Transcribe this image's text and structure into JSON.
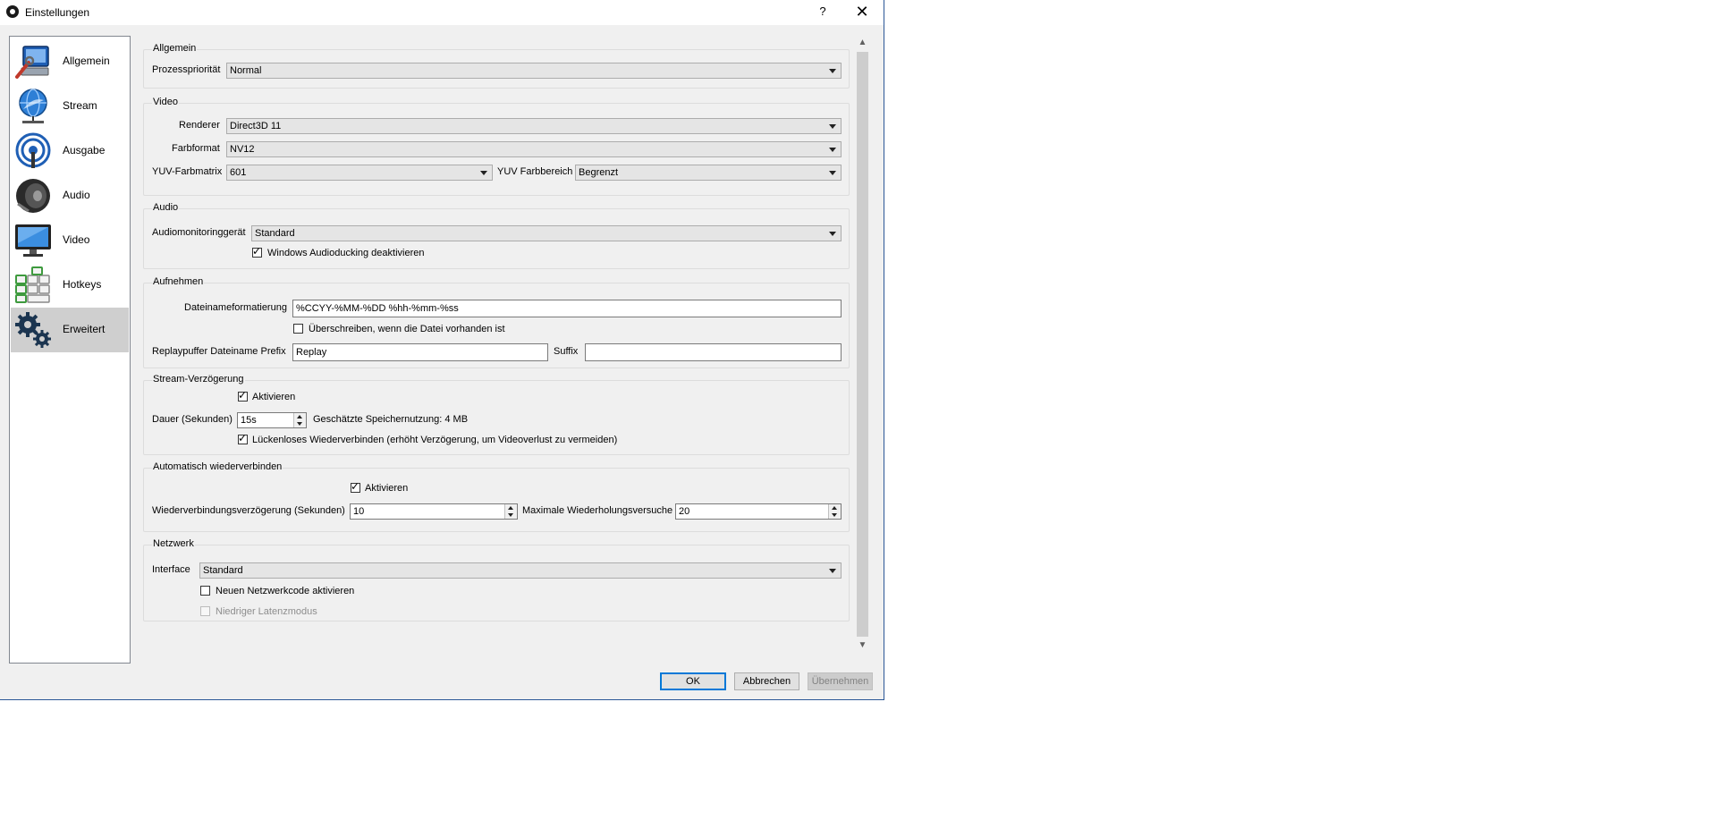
{
  "window": {
    "title": "Einstellungen",
    "help_glyph": "?",
    "close_glyph": "✕",
    "accent": "#2b5797"
  },
  "sidebar": {
    "items": [
      {
        "label": "Allgemein",
        "icon": "computer-wrench-icon",
        "selected": false
      },
      {
        "label": "Stream",
        "icon": "globe-network-icon",
        "selected": false
      },
      {
        "label": "Ausgabe",
        "icon": "broadcast-antenna-icon",
        "selected": false
      },
      {
        "label": "Audio",
        "icon": "speaker-icon",
        "selected": false
      },
      {
        "label": "Video",
        "icon": "monitor-icon",
        "selected": false
      },
      {
        "label": "Hotkeys",
        "icon": "keyboard-icon",
        "selected": false
      },
      {
        "label": "Erweitert",
        "icon": "gears-icon",
        "selected": true
      }
    ]
  },
  "general": {
    "title": "Allgemein",
    "priority_label": "Prozesspriorität",
    "priority_value": "Normal"
  },
  "video": {
    "title": "Video",
    "renderer_label": "Renderer",
    "renderer_value": "Direct3D 11",
    "color_format_label": "Farbformat",
    "color_format_value": "NV12",
    "yuv_matrix_label": "YUV-Farbmatrix",
    "yuv_matrix_value": "601",
    "yuv_range_label": "YUV Farbbereich",
    "yuv_range_value": "Begrenzt"
  },
  "audio": {
    "title": "Audio",
    "monitor_device_label": "Audiomonitoringgerät",
    "monitor_device_value": "Standard",
    "ducking_label": "Windows Audioducking deaktivieren",
    "ducking_checked": true
  },
  "recording": {
    "title": "Aufnehmen",
    "filename_format_label": "Dateinameformatierung",
    "filename_format_value": "%CCYY-%MM-%DD %hh-%mm-%ss",
    "overwrite_label": "Überschreiben, wenn die Datei vorhanden ist",
    "overwrite_checked": false,
    "replay_prefix_label": "Replaypuffer Dateiname Prefix",
    "replay_prefix_value": "Replay",
    "suffix_label": "Suffix",
    "suffix_value": ""
  },
  "stream_delay": {
    "title": "Stream-Verzögerung",
    "enable_label": "Aktivieren",
    "enable_checked": true,
    "duration_label": "Dauer (Sekunden)",
    "duration_value": "15s",
    "memory_estimate": "Geschätzte Speichernutzung: 4 MB",
    "preserve_label": "Lückenloses Wiederverbinden (erhöht Verzögerung, um Videoverlust zu vermeiden)",
    "preserve_checked": true
  },
  "reconnect": {
    "title": "Automatisch wiederverbinden",
    "enable_label": "Aktivieren",
    "enable_checked": true,
    "delay_label": "Wiederverbindungsverzögerung (Sekunden)",
    "delay_value": "10",
    "max_retries_label": "Maximale Wiederholungsversuche",
    "max_retries_value": "20"
  },
  "network": {
    "title": "Netzwerk",
    "interface_label": "Interface",
    "interface_value": "Standard",
    "new_code_label": "Neuen Netzwerkcode aktivieren",
    "new_code_checked": false,
    "low_latency_label": "Niedriger Latenzmodus",
    "low_latency_checked": false
  },
  "footer": {
    "ok_label": "OK",
    "cancel_label": "Abbrechen",
    "apply_label": "Übernehmen"
  }
}
